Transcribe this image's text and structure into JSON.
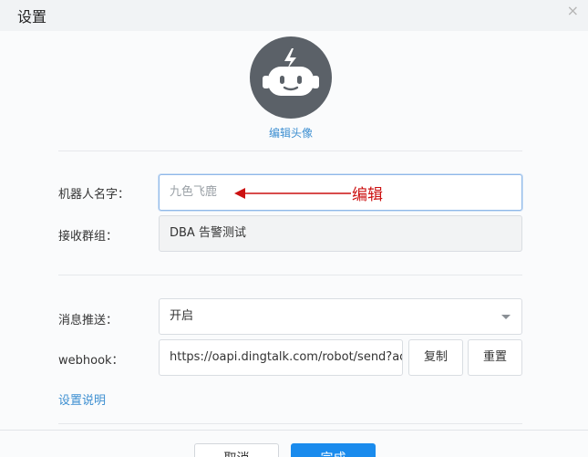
{
  "dialog": {
    "title": "设置",
    "close_icon": "×"
  },
  "avatar": {
    "icon": "robot-icon",
    "edit_label": "编辑头像"
  },
  "form": {
    "robot_name": {
      "label": "机器人名字：",
      "placeholder": "九色飞鹿"
    },
    "receive_group": {
      "label": "接收群组：",
      "value": "DBA 告警测试"
    },
    "message_push": {
      "label": "消息推送：",
      "value": "开启"
    },
    "webhook": {
      "label": "webhook：",
      "value": "https://oapi.dingtalk.com/robot/send?access_token=",
      "copy_label": "复制",
      "reset_label": "重置"
    },
    "help_link": "设置说明"
  },
  "annotation": {
    "text": "编辑",
    "color": "#cc1111"
  },
  "footer": {
    "cancel_label": "取消",
    "done_label": "完成"
  },
  "colors": {
    "link": "#3d8fd1",
    "primary": "#1a8bed",
    "avatar_bg": "#5b6168"
  }
}
